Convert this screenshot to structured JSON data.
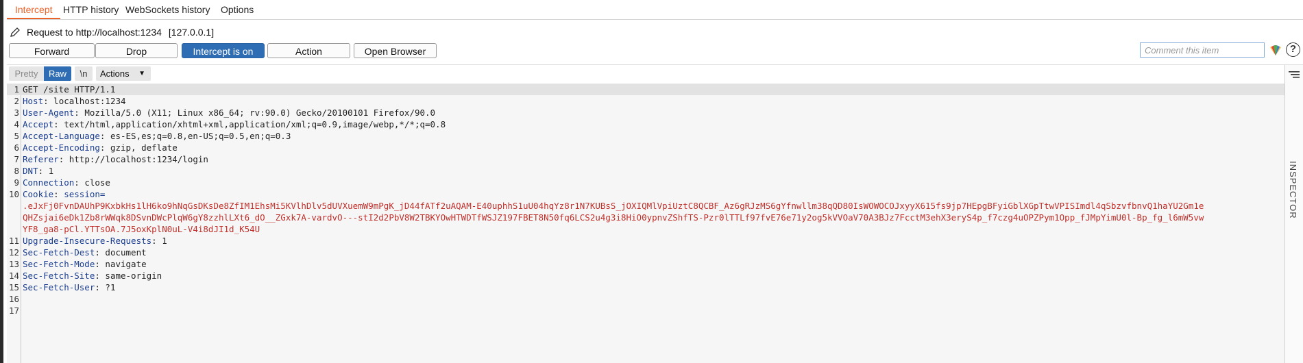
{
  "tabs": [
    {
      "label": "Intercept",
      "active": true
    },
    {
      "label": "HTTP history",
      "active": false
    },
    {
      "label": "WebSockets history",
      "active": false
    },
    {
      "label": "Options",
      "active": false
    }
  ],
  "request": {
    "label": "Request to http://localhost:1234",
    "address": "[127.0.0.1]"
  },
  "buttons": {
    "forward": "Forward",
    "drop": "Drop",
    "intercept": "Intercept is on",
    "action": "Action",
    "open_browser": "Open Browser"
  },
  "comment": {
    "placeholder": "Comment this item",
    "value": ""
  },
  "editor_toolbar": {
    "pretty": "Pretty",
    "raw": "Raw",
    "newline": "\\n",
    "actions": "Actions"
  },
  "editor": {
    "lines": [
      {
        "n": "1",
        "name": "",
        "value": "GET /site HTTP/1.1"
      },
      {
        "n": "2",
        "name": "Host",
        "value": " localhost:1234"
      },
      {
        "n": "3",
        "name": "User-Agent",
        "value": " Mozilla/5.0 (X11; Linux x86_64; rv:90.0) Gecko/20100101 Firefox/90.0"
      },
      {
        "n": "4",
        "name": "Accept",
        "value": " text/html,application/xhtml+xml,application/xml;q=0.9,image/webp,*/*;q=0.8"
      },
      {
        "n": "5",
        "name": "Accept-Language",
        "value": " es-ES,es;q=0.8,en-US;q=0.5,en;q=0.3"
      },
      {
        "n": "6",
        "name": "Accept-Encoding",
        "value": " gzip, deflate"
      },
      {
        "n": "7",
        "name": "Referer",
        "value": " http://localhost:1234/login"
      },
      {
        "n": "8",
        "name": "DNT",
        "value": " 1"
      },
      {
        "n": "9",
        "name": "Connection",
        "value": " close"
      },
      {
        "n": "10",
        "name": "Cookie",
        "value": " session="
      },
      {
        "n": "11",
        "name": "Upgrade-Insecure-Requests",
        "value": " 1"
      },
      {
        "n": "12",
        "name": "Sec-Fetch-Dest",
        "value": " document"
      },
      {
        "n": "13",
        "name": "Sec-Fetch-Mode",
        "value": " navigate"
      },
      {
        "n": "14",
        "name": "Sec-Fetch-Site",
        "value": " same-origin"
      },
      {
        "n": "15",
        "name": "Sec-Fetch-User",
        "value": " ?1"
      },
      {
        "n": "16",
        "name": "",
        "value": ""
      },
      {
        "n": "17",
        "name": "",
        "value": ""
      }
    ],
    "cookie_value": [
      ".eJxFj0FvnDAUhP9KxbkHs1lH6ko9hNqGsDKsDe8ZfIM1EhsMi5KVlhDlv5dUVXuemW9mPgK_jD44fATf2uAQAM-E40uphhS1uU04hqYz8r1N7KUBsS_jOXIQMlVpiUztC8QCBF_Az6gRJzMS6gYfnwllm38qQD80IsWOWOCOJxyyX615fs9jp7HEpgBFyiGblXGpTtwVPISImdl4qSbzvfbnvQ1haYU2Gm1e",
      "QHZsjai6eDk1Zb8rWWqk8DSvnDWcPlqW6gY8zzhlLXt6_dO__ZGxk7A-vardvO---stI2d2PbV8W2TBKYOwHTWDTfWSJZ197FBET8N50fq6LCS2u4g3i8HiO0ypnvZShfTS-Pzr0lTTLf97fvE76e71y2og5kVVOaV70A3BJz7FcctM3ehX3eryS4p_f7czg4uOPZPym1Opp_fJMpYimU0l-Bp_fg_l6mW5vw",
      "YF8_ga8-pCl.YTTsOA.7J5oxKplN0uL-V4i8dJI1d_K54U"
    ]
  },
  "inspector": {
    "label": "INSPECTOR"
  },
  "colors": {
    "accent": "#e8622a",
    "primary_button": "#2e6db3",
    "header_name": "#1a3d8f",
    "cookie_value": "#c0302b"
  }
}
